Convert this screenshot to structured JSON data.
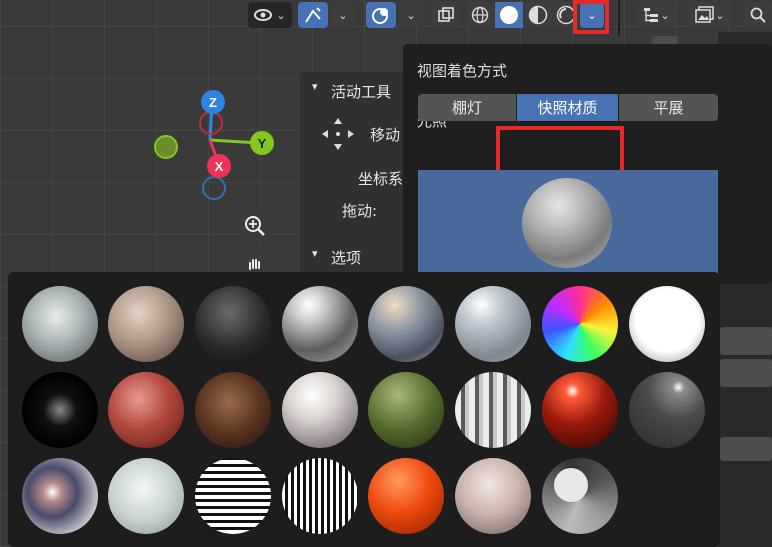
{
  "popup": {
    "title": "视图着色方式",
    "lighting_label": "光照",
    "lighting_options": [
      "棚灯",
      "快照材质",
      "平展"
    ],
    "active_option": "快照材质"
  },
  "tool_panel": {
    "section_active_tool": "活动工具",
    "move_label": "移动",
    "coord_label": "坐标系",
    "drag_label": "拖动:",
    "section_options": "选项"
  },
  "gizmo": {
    "z": "Z",
    "y": "Y",
    "x": "X"
  },
  "colors": {
    "accent": "#4772b3",
    "highlight_box": "#e32b2b",
    "axis_x": "#f0325a",
    "axis_y": "#82c81e",
    "axis_z": "#2f83e3"
  },
  "matcaps": [
    "basic_1",
    "skin",
    "dark_clay",
    "metal_chrome",
    "metal_anisotropic",
    "ceramic_light",
    "rainbow_normal",
    "white_glow",
    "black_reflective",
    "red_clay",
    "brown_leather",
    "pearl",
    "olive_green",
    "striped_chrome",
    "red_gloss",
    "dark_gloss",
    "chrome_reflection",
    "white_jade",
    "stripes_horizontal",
    "stripes_vertical",
    "orange_plastic",
    "skin_light",
    "check_normal"
  ]
}
